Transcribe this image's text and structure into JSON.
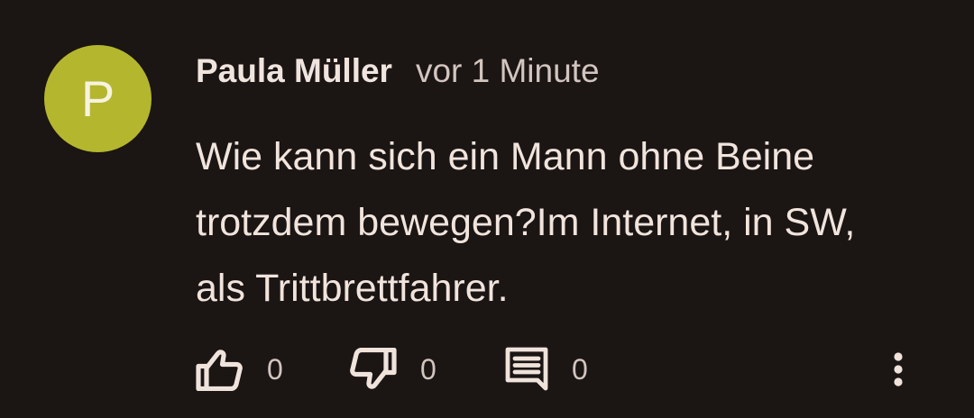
{
  "comment": {
    "avatar_letter": "P",
    "avatar_color": "#b4b62e",
    "author": "Paula Müller",
    "timestamp": "vor 1 Minute",
    "text_lines": [
      "Wie kann sich ein Mann ohne Beine",
      "trotzdem bewegen?Im Internet, in SW,",
      "als Trittbrettfahrer."
    ]
  },
  "actions": {
    "like_icon": "thumbs-up-icon",
    "like_count": "0",
    "dislike_icon": "thumbs-down-icon",
    "dislike_count": "0",
    "reply_icon": "comment-icon",
    "reply_count": "0",
    "more_icon": "more-vertical-icon"
  },
  "colors": {
    "background": "#1b1513",
    "text": "#f0e4dd",
    "secondary_text": "#d2c5bf"
  }
}
